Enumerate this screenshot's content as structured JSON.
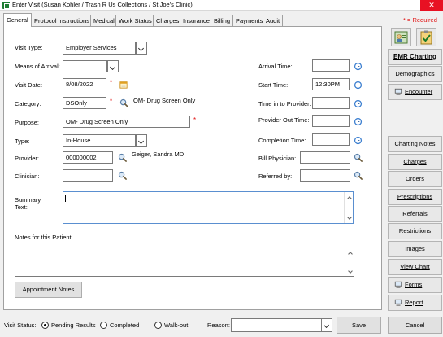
{
  "window": {
    "title": "Enter Visit (Susan Kohler / Trash R Us Collections / St Joe's Clinic)",
    "close_glyph": "✕"
  },
  "tabs": [
    "General",
    "Protocol Instructions",
    "Medical",
    "Work Status",
    "Charges",
    "Insurance",
    "Billing",
    "Payments",
    "Audit"
  ],
  "required_note": "* = Required",
  "form": {
    "visit_type": {
      "label": "Visit Type:",
      "value": "Employer Services"
    },
    "means_of_arrival": {
      "label": "Means of Arrival:",
      "value": ""
    },
    "visit_date": {
      "label": "Visit Date:",
      "value": "8/08/2022"
    },
    "category": {
      "label": "Category:",
      "value": "DSOnly",
      "description": "OM- Drug Screen Only"
    },
    "purpose": {
      "label": "Purpose:",
      "value": "OM- Drug Screen Only"
    },
    "type": {
      "label": "Type:",
      "value": "In-House"
    },
    "provider": {
      "label": "Provider:",
      "value": "000000002",
      "name": "Geiger, Sandra  MD"
    },
    "clinician": {
      "label": "Clinician:",
      "value": ""
    },
    "arrival_time": {
      "label": "Arrival Time:",
      "value": ""
    },
    "start_time": {
      "label": "Start Time:",
      "value": "12:30PM"
    },
    "time_in_to_provider": {
      "label": "Time in to Provider:",
      "value": ""
    },
    "provider_out_time": {
      "label": "Provider Out Time:",
      "value": ""
    },
    "completion_time": {
      "label": "Completion Time:",
      "value": ""
    },
    "bill_physician": {
      "label": "Bill Physician:",
      "value": ""
    },
    "referred_by": {
      "label": "Referred by:",
      "value": ""
    },
    "summary_text": {
      "label_line1": "Summary",
      "label_line2": "Text:",
      "value": ""
    },
    "notes_label": "Notes for this Patient",
    "appointment_notes_button": "Appointment Notes",
    "required_mark": "*"
  },
  "sidebar": {
    "emr_charting": "EMR Charting",
    "demographics": "Demographics",
    "encounter": "Encounter",
    "charting_notes": "Charting Notes",
    "charges": "Charges",
    "orders": "Orders",
    "prescriptions": "Prescriptions",
    "referrals": "Referrals",
    "restrictions": "Restrictions",
    "images": "Images",
    "view_chart": "View Chart",
    "forms": "Forms",
    "report": "Report"
  },
  "bottom": {
    "visit_status_label": "Visit Status:",
    "options": [
      "Pending Results",
      "Completed",
      "Walk-out"
    ],
    "selected_option": "Pending Results",
    "reason_label": "Reason:",
    "reason_value": "",
    "save_button": "Save",
    "cancel_button": "Cancel"
  },
  "colors": {
    "required": "#e01010",
    "clock_icon": "#3c7fd0",
    "magnify_icon": "#5a7fa8",
    "calendar_icon": "#e0a020",
    "title_close": "#e81123",
    "app_icon": "#1e7d32"
  }
}
